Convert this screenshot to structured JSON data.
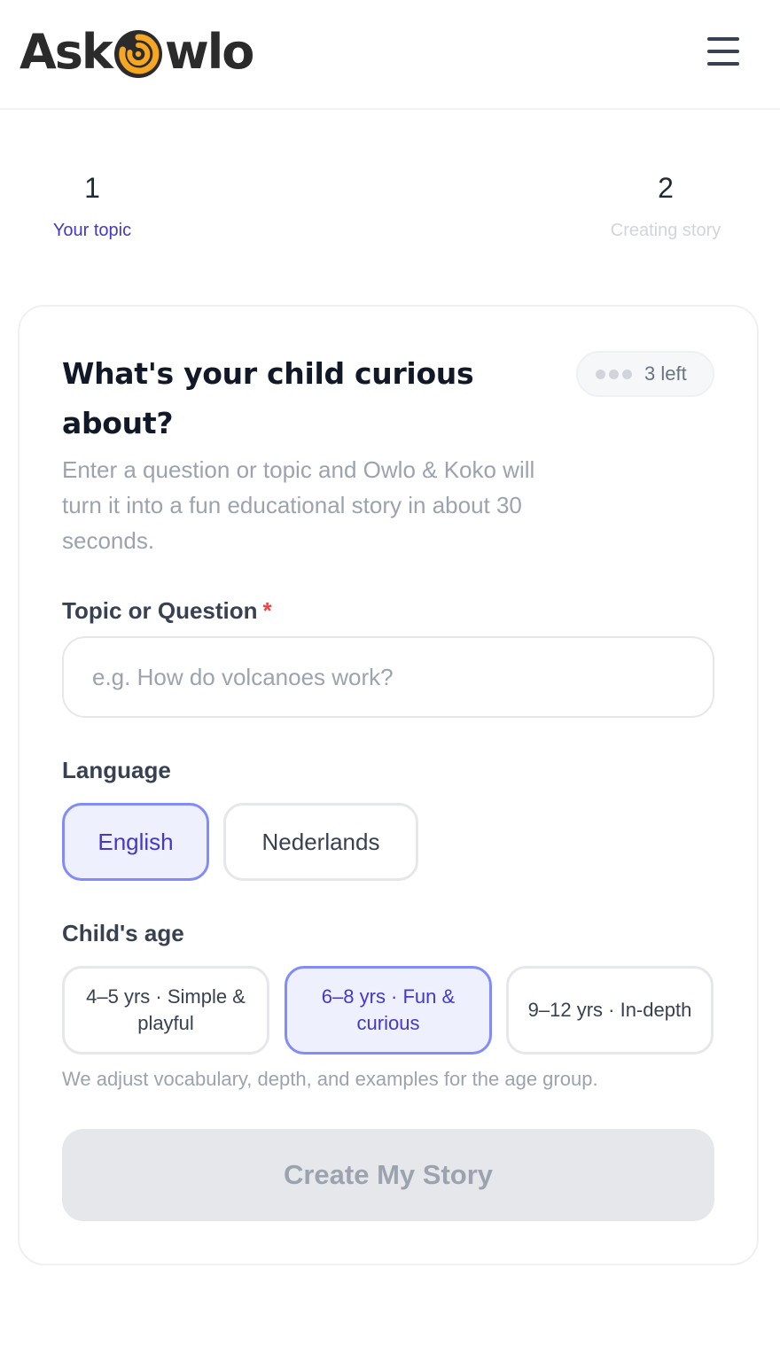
{
  "header": {
    "logo": {
      "prefix": "Ask",
      "suffix": "wlo",
      "icon": "owl-swirl-icon",
      "accent": "#F5A623"
    },
    "menu_icon": "hamburger-menu-icon"
  },
  "steps": [
    {
      "number": "1",
      "label": "Your topic",
      "active": true
    },
    {
      "number": "2",
      "label": "Creating story",
      "active": false
    }
  ],
  "form": {
    "title": "What's your child curious about?",
    "credits": {
      "count_label": "3 left",
      "dots": 3
    },
    "description": "Enter a question or topic and Owlo & Koko will turn it into a fun educational story in about 30 seconds.",
    "topic": {
      "label": "Topic or Question",
      "required_mark": "*",
      "value": "",
      "placeholder": "e.g. How do volcanoes work?"
    },
    "language": {
      "label": "Language",
      "options": [
        {
          "label": "English",
          "selected": true
        },
        {
          "label": "Nederlands",
          "selected": false
        }
      ]
    },
    "age": {
      "label": "Child's age",
      "options": [
        {
          "label": "4–5 yrs · Simple & playful",
          "selected": false
        },
        {
          "label": "6–8 yrs · Fun & curious",
          "selected": true
        },
        {
          "label": "9–12 yrs · In-depth",
          "selected": false
        }
      ],
      "hint": "We adjust vocabulary, depth, and examples for the age group."
    },
    "submit_label": "Create My Story",
    "submit_disabled": true
  },
  "colors": {
    "accent": "#4338CA",
    "selected_border": "#818CF8",
    "selected_bg": "#EEF0FD",
    "required": "#EF4444",
    "muted": "#9CA3AF"
  }
}
